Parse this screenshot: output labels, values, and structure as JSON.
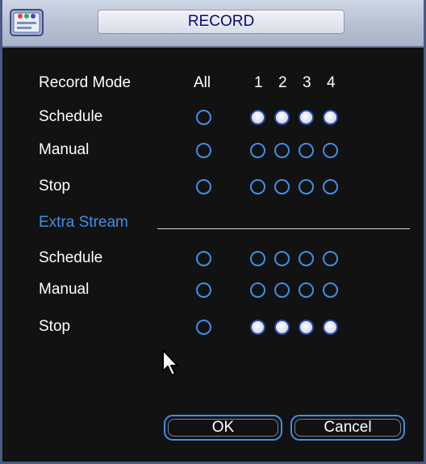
{
  "window": {
    "title": "RECORD"
  },
  "columns": {
    "all": "All",
    "channels": [
      "1",
      "2",
      "3",
      "4"
    ]
  },
  "main_stream": {
    "header_label": "Record Mode",
    "rows": [
      {
        "label": "Schedule",
        "all": false,
        "channels": [
          true,
          true,
          true,
          true
        ]
      },
      {
        "label": "Manual",
        "all": false,
        "channels": [
          false,
          false,
          false,
          false
        ]
      },
      {
        "label": "Stop",
        "all": false,
        "channels": [
          false,
          false,
          false,
          false
        ]
      }
    ]
  },
  "extra_stream": {
    "section_label": "Extra Stream",
    "rows": [
      {
        "label": "Schedule",
        "all": false,
        "channels": [
          false,
          false,
          false,
          false
        ]
      },
      {
        "label": "Manual",
        "all": false,
        "channels": [
          false,
          false,
          false,
          false
        ]
      },
      {
        "label": "Stop",
        "all": false,
        "channels": [
          true,
          true,
          true,
          true
        ]
      }
    ]
  },
  "buttons": {
    "ok": "OK",
    "cancel": "Cancel"
  },
  "colors": {
    "accent": "#3f8fe8",
    "title_text": "#0a0a70",
    "background": "#121212"
  },
  "icons": {
    "app": "record-app-icon",
    "pointer": "mouse-pointer-icon"
  }
}
